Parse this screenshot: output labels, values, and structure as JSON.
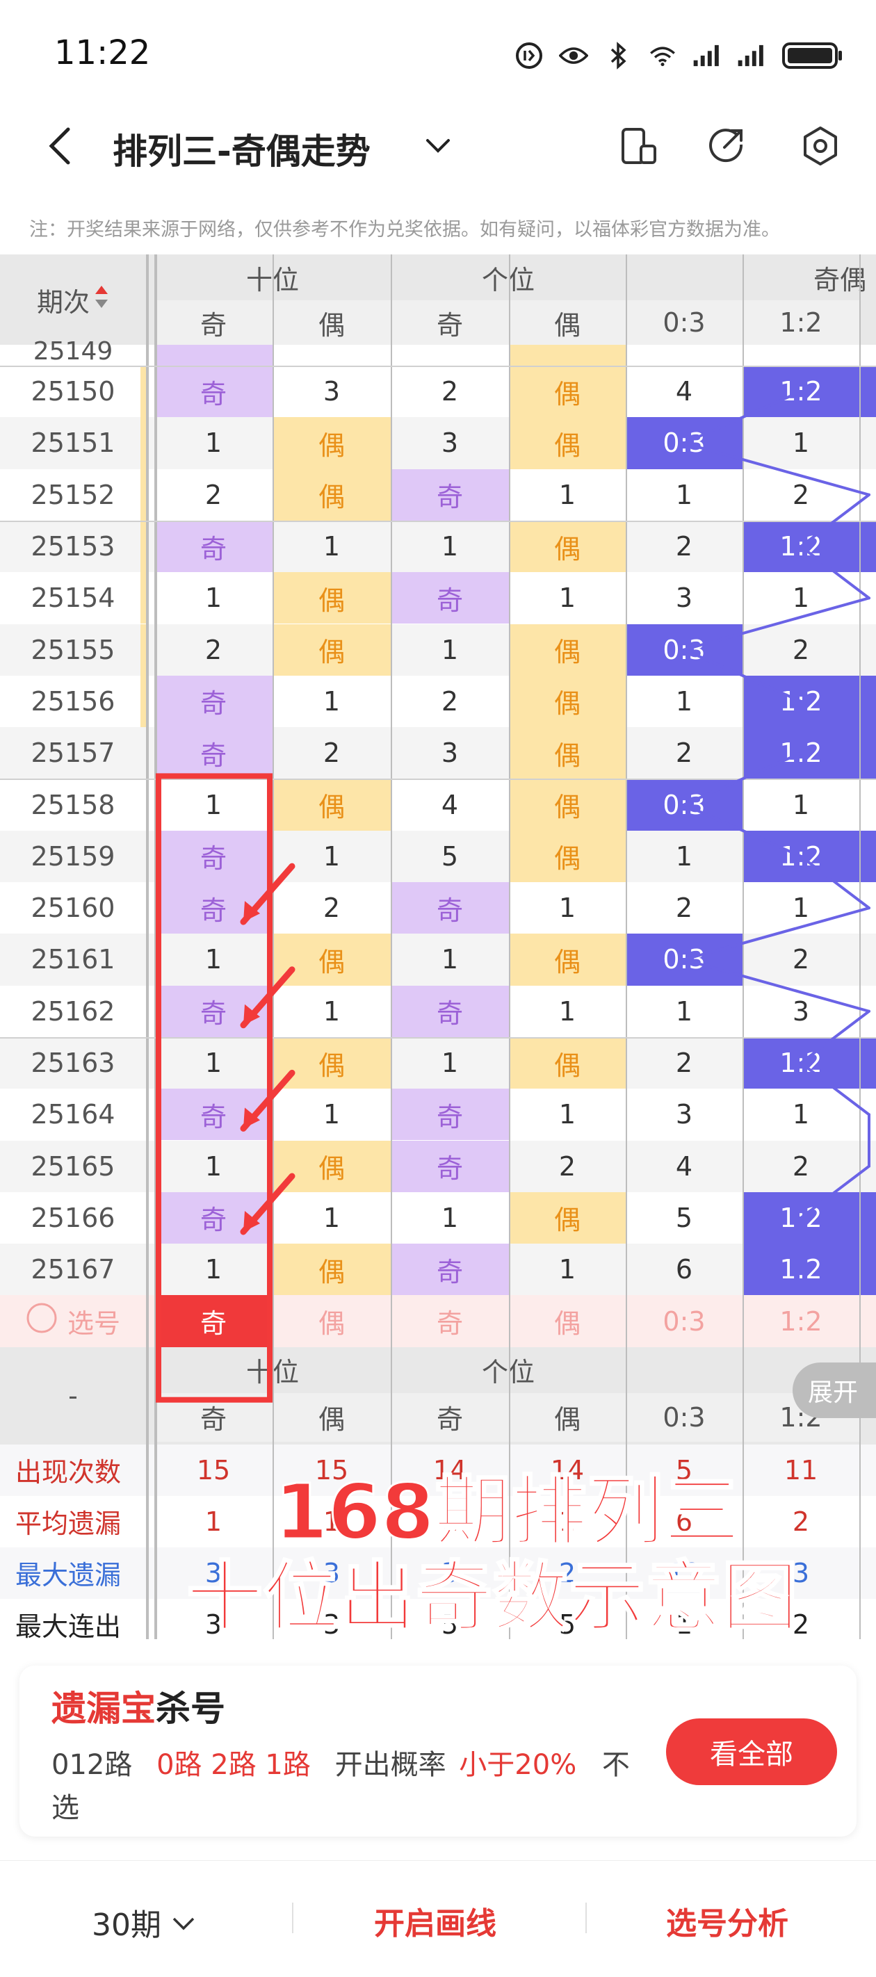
{
  "status_bar": {
    "time": "11:22"
  },
  "header": {
    "title": "排列三-奇偶走势"
  },
  "notice": "注：开奖结果来源于网络，仅供参考不作为兑奖依据。如有疑问，以福体彩官方数据为准。",
  "table": {
    "period_header": "期次",
    "group_headers": [
      "十位",
      "个位",
      "奇偶"
    ],
    "sub_headers": [
      "奇",
      "偶",
      "奇",
      "偶",
      "0:3",
      "1:2"
    ],
    "partial_top_row": "25149",
    "rows": [
      {
        "period": "25150",
        "cells": [
          "奇",
          "3",
          "2",
          "偶",
          "4",
          "1:2"
        ]
      },
      {
        "period": "25151",
        "cells": [
          "1",
          "偶",
          "3",
          "偶",
          "0:3",
          "1"
        ]
      },
      {
        "period": "25152",
        "cells": [
          "2",
          "偶",
          "奇",
          "1",
          "1",
          "2"
        ]
      },
      {
        "period": "25153",
        "cells": [
          "奇",
          "1",
          "1",
          "偶",
          "2",
          "1:2"
        ]
      },
      {
        "period": "25154",
        "cells": [
          "1",
          "偶",
          "奇",
          "1",
          "3",
          "1"
        ]
      },
      {
        "period": "25155",
        "cells": [
          "2",
          "偶",
          "1",
          "偶",
          "0:3",
          "2"
        ]
      },
      {
        "period": "25156",
        "cells": [
          "奇",
          "1",
          "2",
          "偶",
          "1",
          "1:2"
        ]
      },
      {
        "period": "25157",
        "cells": [
          "奇",
          "2",
          "3",
          "偶",
          "2",
          "1:2"
        ]
      },
      {
        "period": "25158",
        "cells": [
          "1",
          "偶",
          "4",
          "偶",
          "0:3",
          "1"
        ]
      },
      {
        "period": "25159",
        "cells": [
          "奇",
          "1",
          "5",
          "偶",
          "1",
          "1:2"
        ]
      },
      {
        "period": "25160",
        "cells": [
          "奇",
          "2",
          "奇",
          "1",
          "2",
          "1"
        ]
      },
      {
        "period": "25161",
        "cells": [
          "1",
          "偶",
          "1",
          "偶",
          "0:3",
          "2"
        ]
      },
      {
        "period": "25162",
        "cells": [
          "奇",
          "1",
          "奇",
          "1",
          "1",
          "3"
        ]
      },
      {
        "period": "25163",
        "cells": [
          "1",
          "偶",
          "1",
          "偶",
          "2",
          "1:2"
        ]
      },
      {
        "period": "25164",
        "cells": [
          "奇",
          "1",
          "奇",
          "1",
          "3",
          "1"
        ]
      },
      {
        "period": "25165",
        "cells": [
          "1",
          "偶",
          "奇",
          "2",
          "4",
          "2"
        ]
      },
      {
        "period": "25166",
        "cells": [
          "奇",
          "1",
          "1",
          "偶",
          "5",
          "1:2"
        ]
      },
      {
        "period": "25167",
        "cells": [
          "1",
          "偶",
          "奇",
          "1",
          "6",
          "1:2"
        ]
      }
    ],
    "select_row": {
      "label": "选号",
      "cells": [
        "奇",
        "偶",
        "奇",
        "偶",
        "0:3",
        "1:2"
      ]
    },
    "footer_dash": "-",
    "expand_label": "展开",
    "stats": [
      {
        "label": "出现次数",
        "color": "#d0342c",
        "values": [
          "15",
          "15",
          "14",
          "14",
          "5",
          "11"
        ]
      },
      {
        "label": "平均遗漏",
        "color": "#d0342c",
        "values": [
          "1",
          "1",
          "1",
          "1",
          "6",
          "2"
        ]
      },
      {
        "label": "最大遗漏",
        "color": "#3a6fd8",
        "values": [
          "3",
          "3",
          "3",
          "2",
          "12",
          "3"
        ]
      },
      {
        "label": "最大连出",
        "color": "#222222",
        "values": [
          "3",
          "3",
          "5",
          "5",
          "1",
          "2"
        ]
      }
    ]
  },
  "overlay": {
    "line1": "168期排列三",
    "line2": "十位出奇数示意图"
  },
  "card": {
    "title_red": "遗漏宝",
    "title_black": "杀号",
    "route_label": "012路",
    "routes": "0路 2路 1路",
    "prob_label": "开出概率",
    "prob_value": "小于20%",
    "tail1": "不",
    "tail2": "选",
    "button": "看全部"
  },
  "bottom_bar": {
    "periods": "30期",
    "draw_lines": "开启画线",
    "analysis": "选号分析"
  },
  "colors": {
    "purple": "#dfc8f7",
    "yellow": "#fde5a8",
    "blue": "#6a63e6",
    "red": "#f0393a"
  }
}
